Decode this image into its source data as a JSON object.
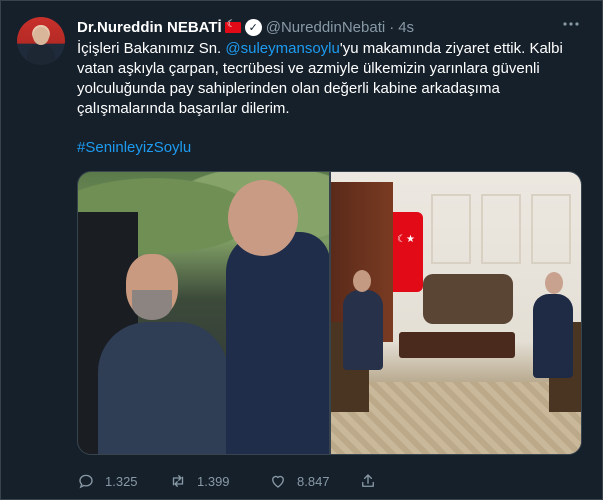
{
  "tweet": {
    "author": {
      "name": "Dr.Nureddin NEBATİ",
      "handle": "@NureddinNebati",
      "time": "4s",
      "separator": "·"
    },
    "text_before_mention": "İçişleri Bakanımız Sn. ",
    "mention": "@suleymansoylu",
    "text_after_mention": "'yu makamında ziyaret ettik. Kalbi vatan aşkıyla çarpan, tecrübesi ve azmiyle ülkemizin yarınlara güvenli yolculuğunda pay sahiplerinden olan değerli kabine arkadaşıma çalışmalarında başarılar dilerim.",
    "hashtag": "#SeninleyizSoylu",
    "stats": {
      "replies": "1.325",
      "retweets": "1.399",
      "likes": "8.847"
    }
  },
  "colors": {
    "background": "#15202b",
    "link": "#1d9bf0",
    "secondary_text": "#8899a6"
  },
  "icons": {
    "more": "more-icon",
    "verified": "verified-icon",
    "flag": "turkey-flag-icon",
    "reply": "reply-icon",
    "retweet": "retweet-icon",
    "like": "heart-icon",
    "share": "share-icon"
  }
}
